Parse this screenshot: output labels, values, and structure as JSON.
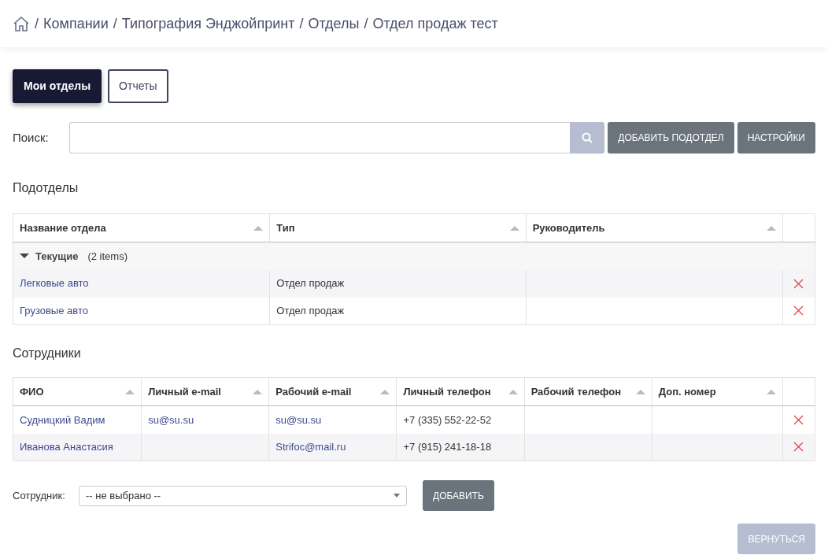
{
  "breadcrumb_separator": "/",
  "breadcrumb": [
    "Компании",
    "Типография Энджойпринт",
    "Отделы",
    "Отдел продаж тест"
  ],
  "tabs": [
    {
      "label": "Мои отделы",
      "selected": true
    },
    {
      "label": "Отчеты",
      "selected": false
    }
  ],
  "search": {
    "label": "Поиск:",
    "buttons": [
      "ДОБАВИТЬ ПОДОТДЕЛ",
      "НАСТРОЙКИ"
    ]
  },
  "subdivisions": {
    "title": "Подотделы",
    "columns": [
      "Название отдела",
      "Тип",
      "Руководитель"
    ],
    "group": {
      "label": "Текущие",
      "count": "(2 items)",
      "expanded": true
    },
    "rows": [
      [
        "Легковые авто",
        "Отдел продаж",
        ""
      ],
      [
        "Грузовые авто",
        "Отдел продаж",
        ""
      ]
    ]
  },
  "employees": {
    "title": "Сотрудники",
    "columns": [
      "ФИО",
      "Личный e-mail",
      "Рабочий e-mail",
      "Личный телефон",
      "Рабочий телефон",
      "Доп. номер"
    ],
    "rows": [
      [
        "Судницкий Вадим",
        "su@su.su",
        "su@su.su",
        "+7 (335) 552-22-52",
        "",
        ""
      ],
      [
        "Иванова Анастасия",
        "",
        "Strifoc@mail.ru",
        "+7 (915) 241-18-18",
        "",
        ""
      ]
    ]
  },
  "employee_picker": {
    "label": "Сотрудник:",
    "value": "-- не выбрано --",
    "button": "ДОБАВИТЬ"
  },
  "back_button": {
    "label": "ВЕРНУТЬСЯ",
    "disabled": true
  }
}
